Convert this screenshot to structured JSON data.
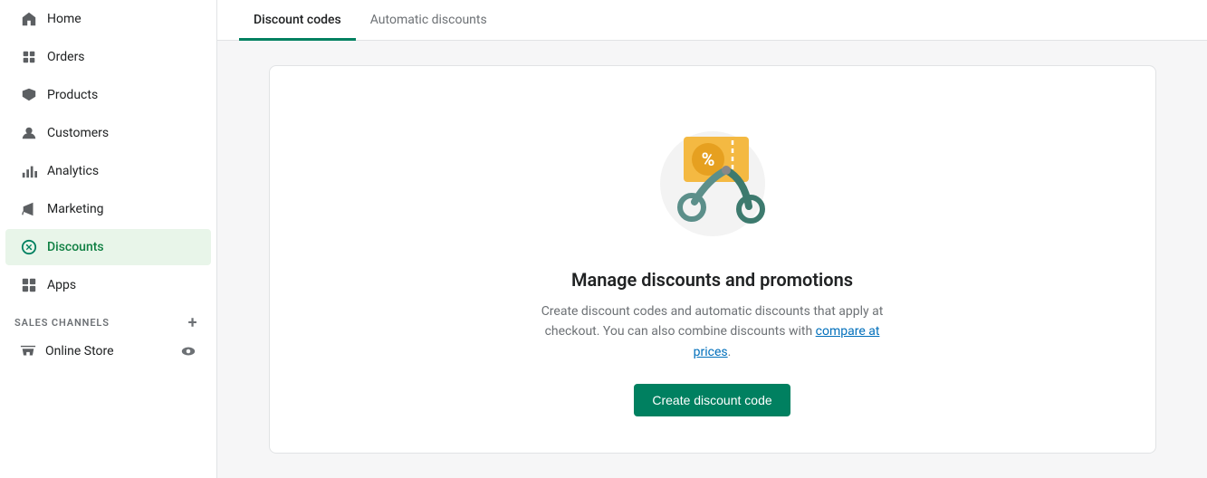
{
  "sidebar": {
    "items": [
      {
        "id": "home",
        "label": "Home",
        "icon": "home-icon"
      },
      {
        "id": "orders",
        "label": "Orders",
        "icon": "orders-icon"
      },
      {
        "id": "products",
        "label": "Products",
        "icon": "products-icon"
      },
      {
        "id": "customers",
        "label": "Customers",
        "icon": "customers-icon"
      },
      {
        "id": "analytics",
        "label": "Analytics",
        "icon": "analytics-icon"
      },
      {
        "id": "marketing",
        "label": "Marketing",
        "icon": "marketing-icon"
      },
      {
        "id": "discounts",
        "label": "Discounts",
        "icon": "discounts-icon",
        "active": true
      },
      {
        "id": "apps",
        "label": "Apps",
        "icon": "apps-icon"
      }
    ],
    "sales_channels_label": "SALES CHANNELS",
    "online_store_label": "Online Store"
  },
  "tabs": [
    {
      "id": "discount-codes",
      "label": "Discount codes",
      "active": true
    },
    {
      "id": "automatic-discounts",
      "label": "Automatic discounts",
      "active": false
    }
  ],
  "empty_state": {
    "title": "Manage discounts and promotions",
    "description_part1": "Create discount codes and automatic discounts that apply at checkout. You can also combine discounts with ",
    "link_text": "compare at prices",
    "description_part2": ".",
    "button_label": "Create discount code"
  }
}
